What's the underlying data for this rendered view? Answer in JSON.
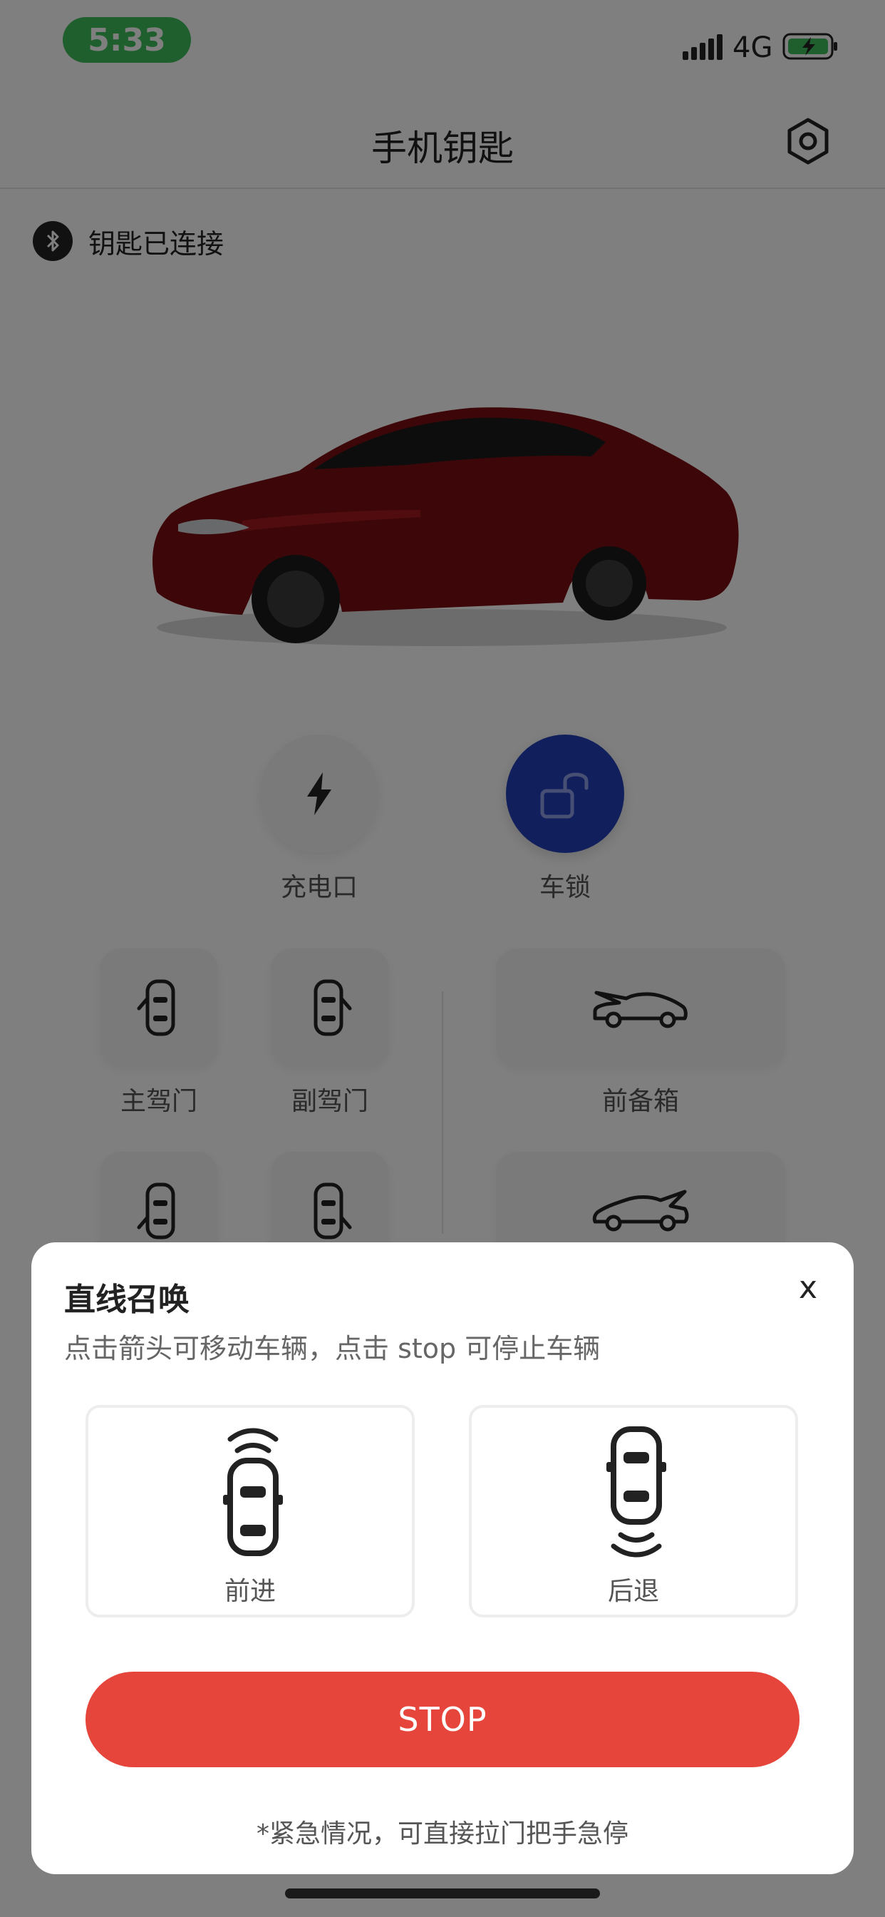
{
  "status_bar": {
    "time": "5:33",
    "network": "4G"
  },
  "header": {
    "title": "手机钥匙"
  },
  "bluetooth": {
    "status": "钥匙已连接"
  },
  "controls": {
    "charge_port": "充电口",
    "lock": "车锁"
  },
  "doors": {
    "driver": "主驾门",
    "passenger": "副驾门",
    "frunk": "前备箱"
  },
  "modal": {
    "title": "直线召唤",
    "close": "x",
    "subtitle": "点击箭头可移动车辆，点击 stop 可停止车辆",
    "forward": "前进",
    "backward": "后退",
    "stop": "STOP",
    "note": "*紧急情况，可直接拉门把手急停"
  },
  "colors": {
    "status_pill": "#3fbf5a",
    "lock_button": "#2240b8",
    "stop_button": "#e5453a",
    "car_body": "#7a0f12"
  }
}
